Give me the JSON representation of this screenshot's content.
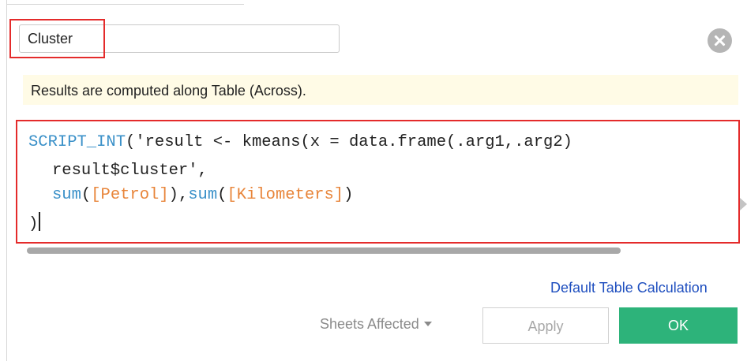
{
  "calc_name": "Cluster",
  "info_message": "Results are computed along Table (Across).",
  "code": {
    "line1_func": "SCRIPT_INT",
    "line1_rest": "('result <- kmeans(x = data.frame(.arg1,.arg2)",
    "line2": "result$cluster',",
    "line3_sum1": "sum",
    "line3_paren1_open": "(",
    "line3_field1": "[Petrol]",
    "line3_paren1_close": "),",
    "line3_sum2": "sum",
    "line3_paren2_open": "(",
    "line3_field2": "[Kilometers]",
    "line3_paren2_close": ")",
    "line4": ")"
  },
  "default_table_calc_label": "Default Table Calculation",
  "sheets_affected_label": "Sheets Affected",
  "apply_label": "Apply",
  "ok_label": "OK",
  "icons": {
    "close": "close-circle-icon",
    "sheets_dropdown": "caret-down-icon",
    "scroll_right": "scroll-right-arrow-icon"
  },
  "colors": {
    "highlight": "#e42b2b",
    "keyword": "#3a90c8",
    "field": "#e8853a",
    "ok_button": "#2db37a",
    "link": "#1f4fbf",
    "info_bg": "#fffbe6"
  }
}
